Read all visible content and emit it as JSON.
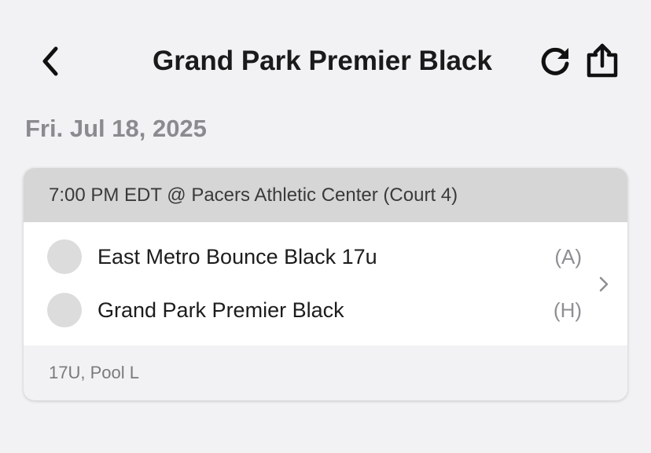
{
  "header": {
    "title": "Grand Park Premier Black",
    "back_icon": "chevron-left-icon",
    "refresh_icon": "refresh-icon",
    "share_icon": "share-icon"
  },
  "date_label": "Fri. Jul 18, 2025",
  "game": {
    "time_location": "7:00 PM EDT @ Pacers Athletic Center (Court 4)",
    "teams": [
      {
        "name": "East Metro Bounce Black 17u",
        "side": "(A)"
      },
      {
        "name": "Grand Park Premier Black",
        "side": "(H)"
      }
    ],
    "division": "17U, Pool L",
    "chevron_icon": "chevron-right-icon"
  },
  "colors": {
    "background": "#f2f2f4",
    "card_header": "#d6d6d6",
    "avatar": "#dcdcdc",
    "title_text": "#1a1a1a",
    "muted_text": "#8b8b8f"
  }
}
